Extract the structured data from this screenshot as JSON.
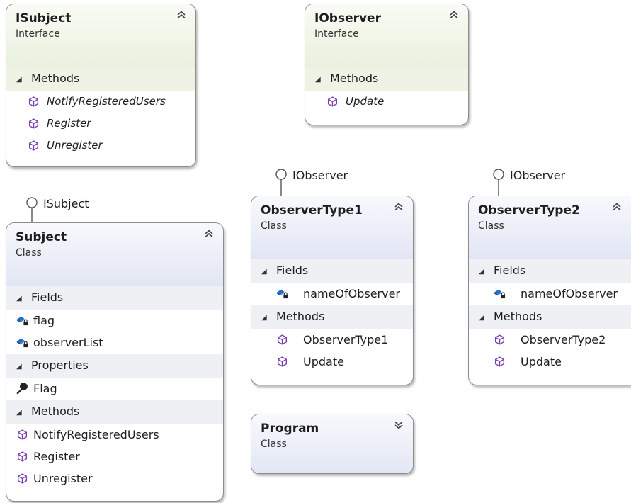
{
  "colors": {
    "interface_header": "#e9f1dd",
    "class_header": "#e2e6f4",
    "method_icon": "#7b3fb0",
    "field_icon": "#1f6fc4",
    "border": "#8c8c8c"
  },
  "isubject": {
    "name": "ISubject",
    "kind": "Interface",
    "methods_label": "Methods",
    "methods": [
      "NotifyRegisteredUsers",
      "Register",
      "Unregister"
    ]
  },
  "iobserver": {
    "name": "IObserver",
    "kind": "Interface",
    "methods_label": "Methods",
    "methods": [
      "Update"
    ]
  },
  "subject": {
    "lollipop": "ISubject",
    "name": "Subject",
    "kind": "Class",
    "fields_label": "Fields",
    "fields": [
      "flag",
      "observerList"
    ],
    "properties_label": "Properties",
    "properties": [
      "Flag"
    ],
    "methods_label": "Methods",
    "methods": [
      "NotifyRegisteredUsers",
      "Register",
      "Unregister"
    ]
  },
  "observer1": {
    "lollipop": "IObserver",
    "name": "ObserverType1",
    "kind": "Class",
    "fields_label": "Fields",
    "fields": [
      "nameOfObserver"
    ],
    "methods_label": "Methods",
    "methods": [
      "ObserverType1",
      "Update"
    ]
  },
  "observer2": {
    "lollipop": "IObserver",
    "name": "ObserverType2",
    "kind": "Class",
    "fields_label": "Fields",
    "fields": [
      "nameOfObserver"
    ],
    "methods_label": "Methods",
    "methods": [
      "ObserverType2",
      "Update"
    ]
  },
  "program": {
    "name": "Program",
    "kind": "Class"
  }
}
